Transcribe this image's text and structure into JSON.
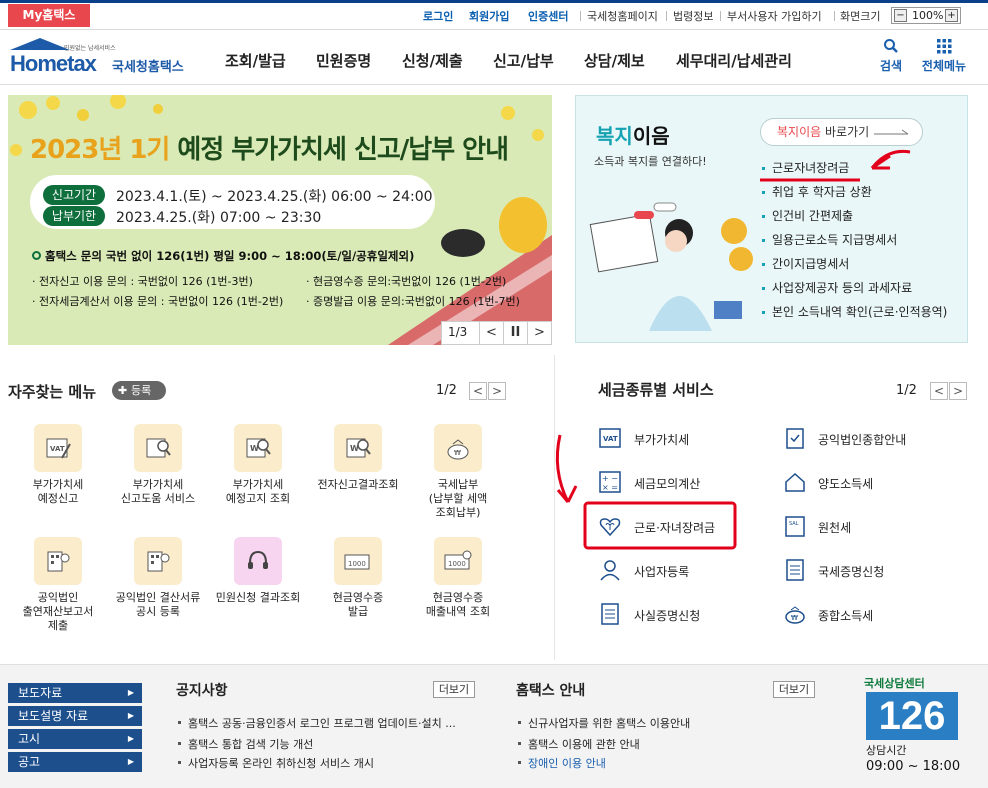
{
  "topbar": {
    "my_hometax": "My홈택스",
    "links": [
      "로그인",
      "회원가입",
      "인증센터",
      "국세청홈페이지",
      "법령정보",
      "부서사용자 가입하기",
      "화면크기"
    ],
    "zoom": "100%",
    "zoom_minus": "−",
    "zoom_plus": "+"
  },
  "logo": {
    "tagline": "민원없는 납세서비스",
    "brand": "Hometax",
    "org": "국세청홈택스"
  },
  "nav": {
    "items": [
      "조회/발급",
      "민원증명",
      "신청/제출",
      "신고/납부",
      "상담/제보",
      "세무대리/납세관리"
    ],
    "search": "검색",
    "menu": "전체메뉴"
  },
  "banner": {
    "title_year": "2023년 1기",
    "title_rest": " 예정 부가가치세 신고/납부 안내",
    "tag1": "신고기간",
    "period1": "2023.4.1.(토) ~ 2023.4.25.(화) 06:00 ~ 24:00",
    "tag2": "납부기한",
    "period2": "2023.4.25.(화) 07:00 ~ 23:30",
    "info": "홈택스 문의 국번 없이 126(1번) 평일 9:00 ~ 18:00(토/일/공휴일제외)",
    "lines": [
      "· 전자신고 이용 문의 : 국번없이 126 (1번-3번)",
      "· 현금영수증 문의:국번없이 126 (1번-2번)",
      "· 전자세금계산서 이용 문의 : 국번없이 126 (1번-2번)",
      "· 증명발급 이용 문의:국번없이 126 (1번-7번)"
    ],
    "page": "1/3",
    "prev": "<",
    "pause": "II",
    "next": ">"
  },
  "welfare": {
    "title_a": "복지",
    "title_b": "이음",
    "subtitle": "소득과 복지를 연결하다!",
    "button_hl": "복지이음",
    "button_rest": " 바로가기",
    "items": [
      "근로자녀장려금",
      "취업 후 학자금 상환",
      "인건비 간편제출",
      "일용근로소득 지급명세서",
      "간이지급명세서",
      "사업장제공자 등의 과세자료",
      "본인 소득내역 확인(근로·인적용역)"
    ]
  },
  "quick": {
    "title": "자주찾는 메뉴",
    "add": "등록",
    "page": "1/2",
    "prev": "<",
    "next": ">",
    "items": [
      {
        "label": "부가가치세\n예정신고",
        "icon": "vat-icon"
      },
      {
        "label": "부가가치세\n신고도움 서비스",
        "icon": "vat-search-icon"
      },
      {
        "label": "부가가치세\n예정고지 조회",
        "icon": "notice-search-icon"
      },
      {
        "label": "전자신고결과조회",
        "icon": "report-search-icon"
      },
      {
        "label": "국세납부\n(납부할 세액\n조회납부)",
        "icon": "money-bag-icon"
      },
      {
        "label": "공익법인\n출연재산보고서\n제출",
        "icon": "building-icon"
      },
      {
        "label": "공익법인 결산서류\n공시 등록",
        "icon": "building-search-icon"
      },
      {
        "label": "민원신청 결과조회",
        "icon": "headset-icon"
      },
      {
        "label": "현금영수증\n발급",
        "icon": "receipt-icon"
      },
      {
        "label": "현금영수증\n매출내역 조회",
        "icon": "receipt-search-icon"
      }
    ]
  },
  "taxsvc": {
    "title": "세금종류별 서비스",
    "page": "1/2",
    "prev": "<",
    "next": ">",
    "left": [
      "부가가치세",
      "세금모의계산",
      "근로·자녀장려금",
      "사업자등록",
      "사실증명신청"
    ],
    "right": [
      "공익법인종합안내",
      "양도소득세",
      "원천세",
      "국세증명신청",
      "종합소득세"
    ]
  },
  "footer": {
    "buttons": [
      "보도자료",
      "보도설명 자료",
      "고시",
      "공고"
    ],
    "notice_title": "공지사항",
    "notice_more": "더보기",
    "notices": [
      "홈택스 공동·금융인증서 로그인 프로그램 업데이트·설치 ...",
      "홈택스 통합 검색 기능 개선",
      "사업자등록 온라인 취하신청 서비스 개시"
    ],
    "guide_title": "홈택스 안내",
    "guide_more": "더보기",
    "guides": [
      "신규사업자를 위한 홈택스 이용안내",
      "홈택스 이용에 관한 안내",
      "장애인 이용 안내"
    ],
    "center_label": "국세상담센터",
    "center_num": "126",
    "hours_label": "상담시간",
    "hours": "09:00 ~ 18:00"
  },
  "colors": {
    "primary": "#1d4f8d",
    "accent_red": "#e8484d",
    "teal": "#15a2b2",
    "annotation": "#e3001b"
  }
}
